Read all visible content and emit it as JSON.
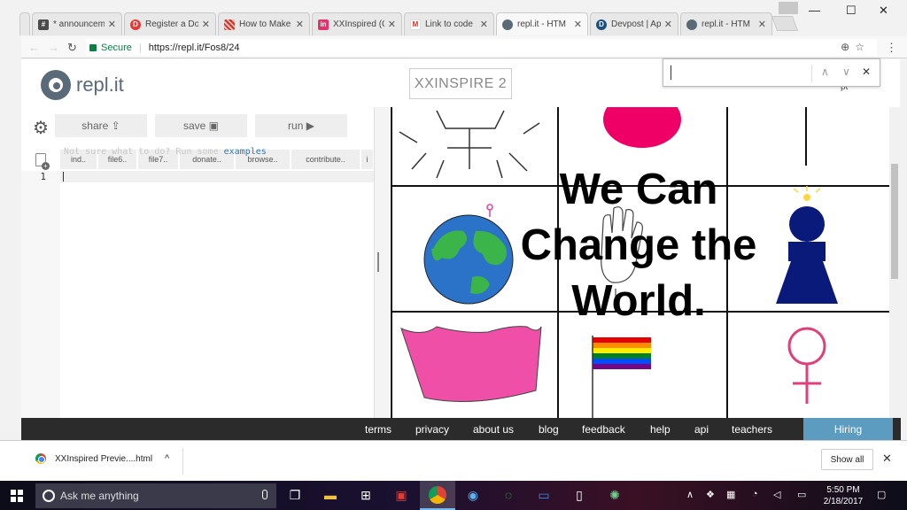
{
  "browser": {
    "tabs": [
      {
        "title": "* announcem",
        "fav_color": "#4a4a4a",
        "fav_glyph": "#"
      },
      {
        "title": "Register a Do",
        "fav_color": "#e53935",
        "fav_glyph": "D"
      },
      {
        "title": "How to Make",
        "fav_color": "#c0392b",
        "fav_glyph": ""
      },
      {
        "title": "XXInspired (C",
        "fav_color": "#e2336b",
        "fav_glyph": "in"
      },
      {
        "title": "Link to code",
        "fav_color": "#ffffff",
        "fav_glyph": "M"
      },
      {
        "title": "repl.it - HTM",
        "fav_color": "#5a6a78",
        "fav_glyph": ""
      },
      {
        "title": "Devpost | Ap",
        "fav_color": "#1c4e80",
        "fav_glyph": "D"
      },
      {
        "title": "repl.it - HTM",
        "fav_color": "#5a6a78",
        "fav_glyph": ""
      }
    ],
    "active_tab_index": 5,
    "secure_label": "Secure",
    "url": "https://repl.it/Fos8/24",
    "window_controls": {
      "minimize": "—",
      "maximize": "☐",
      "close": "✕"
    },
    "find_bar": {
      "up": "∧",
      "down": "∨",
      "close": "✕"
    }
  },
  "page": {
    "logo_text": "repl.it",
    "project_title": "XXINSPIRE 2",
    "corner_text": "pt",
    "editor": {
      "share_label": "share",
      "save_label": "save",
      "run_label": "run",
      "hint_text": "Not sure what to do? Run some ",
      "hint_link": "examples",
      "file_tabs": [
        "ind..",
        "file6..",
        "file7..",
        "donate..",
        "browse..",
        "contribute..",
        "i"
      ],
      "line_numbers": [
        "1"
      ]
    },
    "output": {
      "poster_lines": [
        "We Can",
        "Change the",
        "World."
      ]
    },
    "footer_links": [
      "terms",
      "privacy",
      "about us",
      "blog",
      "feedback",
      "help",
      "api",
      "teachers"
    ],
    "hiring_label": "Hiring"
  },
  "downloads": {
    "file_name": "XXInspired Previe....html",
    "show_all": "Show all",
    "chevron": "^",
    "close": "✕"
  },
  "taskbar": {
    "search_placeholder": "Ask me anything",
    "time": "5:50 PM",
    "date": "2/18/2017"
  }
}
